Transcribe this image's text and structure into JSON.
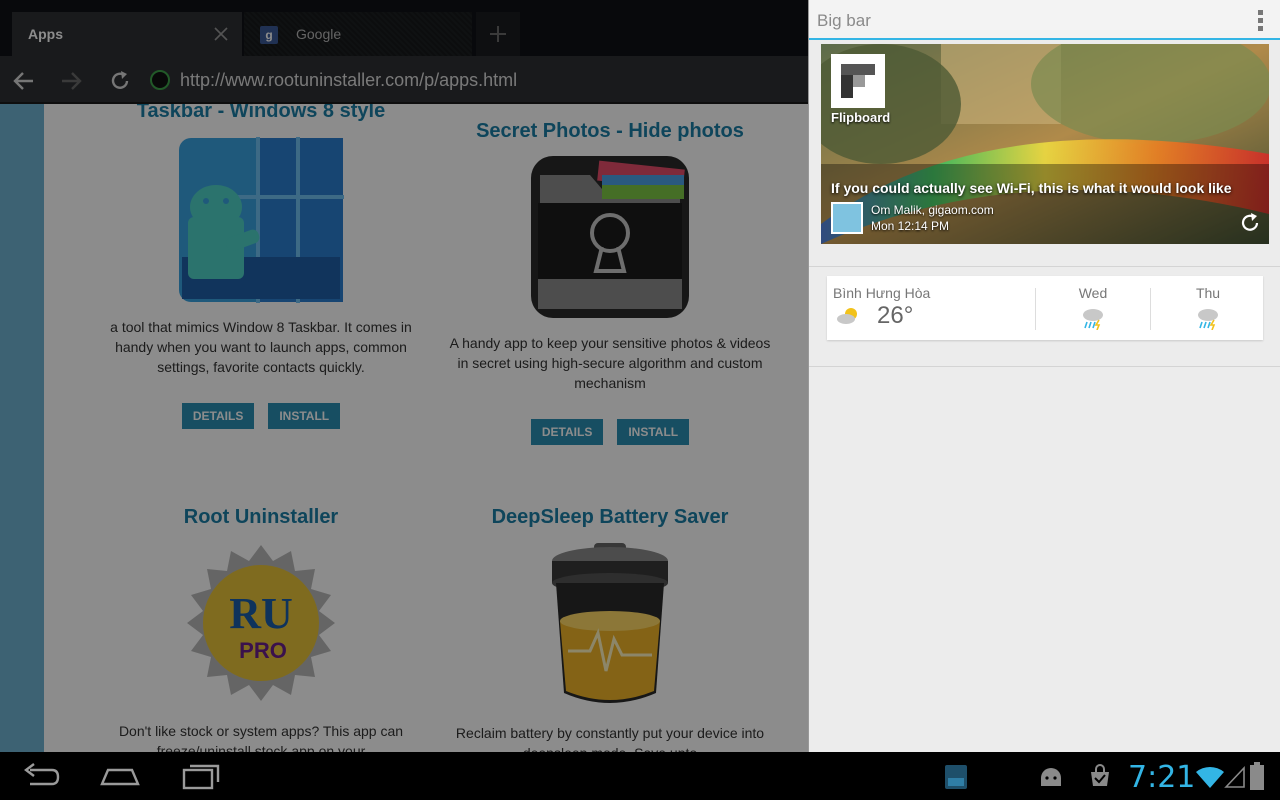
{
  "browser": {
    "tabs": [
      {
        "label": "Apps",
        "active": true
      },
      {
        "label": "Google",
        "active": false
      }
    ],
    "url": "http://www.rootuninstaller.com/p/apps.html"
  },
  "apps": [
    {
      "title": "Taskbar - Windows 8 style",
      "desc": "a tool that mimics Window 8 Taskbar. It comes in handy when you want to launch apps, common settings, favorite contacts quickly.",
      "details": "DETAILS",
      "install": "INSTALL"
    },
    {
      "title": "Secret Photos - Hide photos",
      "desc": "A handy app to keep your sensitive photos & videos in secret using high-secure algorithm and custom mechanism",
      "details": "DETAILS",
      "install": "INSTALL"
    },
    {
      "title": "Root Uninstaller",
      "desc": "Don't like stock or system apps? This app can freeze/uninstall stock app on your",
      "icon_text": "RU",
      "icon_subtext": "PRO"
    },
    {
      "title": "DeepSleep Battery Saver",
      "desc": "Reclaim battery by constantly put your device into deepsleep mode. Save upto"
    }
  ],
  "panel": {
    "title": "Big bar",
    "flipboard": {
      "brand": "Flipboard",
      "headline": "If you could actually see Wi-Fi, this is what it would look like",
      "author": "Om Malik, gigaom.com",
      "time": "Mon 12:14 PM"
    },
    "weather": {
      "location": "Bình Hưng Hòa",
      "temp": "26°",
      "days": [
        "Wed",
        "Thu"
      ]
    }
  },
  "system": {
    "clock": "7:21"
  },
  "colors": {
    "accent": "#33b5e5",
    "link": "#1b7fa6",
    "button": "#2a8fb3"
  }
}
